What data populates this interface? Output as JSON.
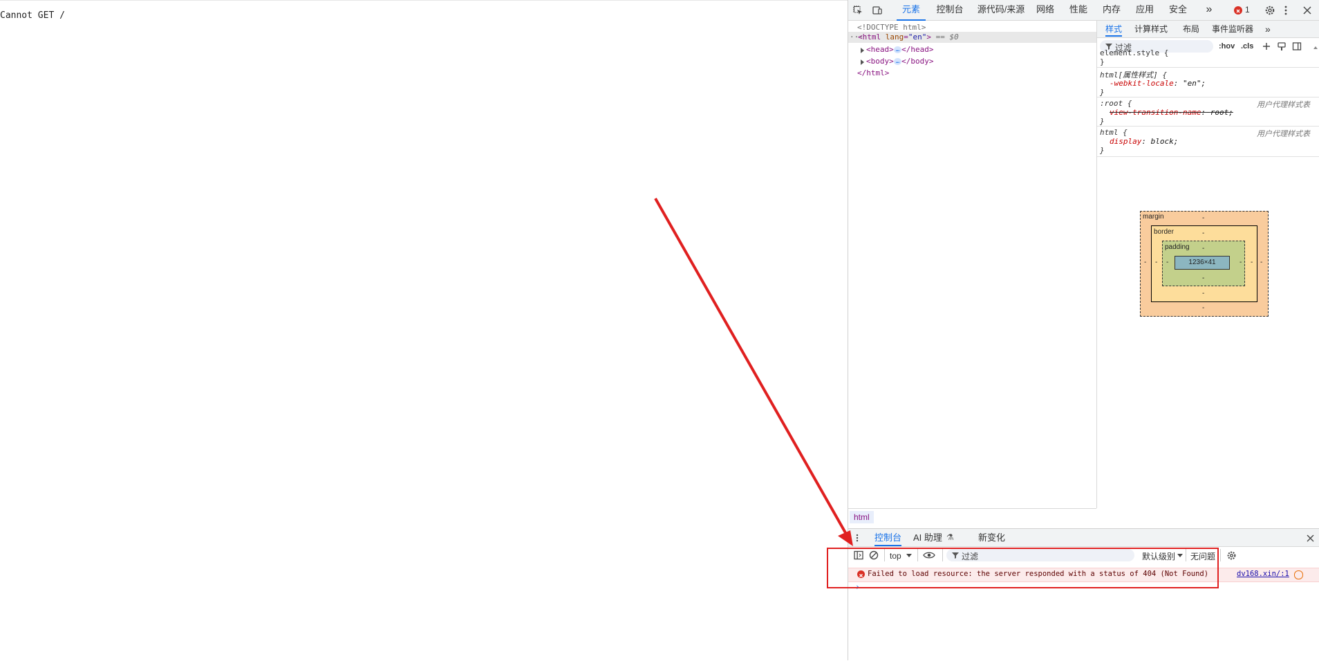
{
  "page": {
    "text": "Cannot GET /"
  },
  "devtools": {
    "tabs": [
      "元素",
      "控制台",
      "源代码/来源",
      "网络",
      "性能",
      "内存",
      "应用",
      "安全"
    ],
    "active_tab": "元素",
    "more_tabs": "»",
    "error_count": "1",
    "dom": {
      "doctype": "<!DOCTYPE html>",
      "html_open": "<html",
      "lang_attr": "lang",
      "lang_value": "\"en\"",
      "html_close_bracket": ">",
      "selected_marker": "== $0",
      "head_open": "<head>",
      "head_close": "</head>",
      "body_open": "<body>",
      "body_close": "</body>",
      "html_close": "</html>",
      "dots": "…",
      "row_dots": "···"
    },
    "breadcrumb": "html",
    "styles": {
      "tabs": [
        "样式",
        "计算样式",
        "布局",
        "事件监听器"
      ],
      "more": "»",
      "filter_placeholder": "过滤",
      "hov": ":hov",
      "cls": ".cls",
      "rules": [
        {
          "selector": "element.style {",
          "close": "}"
        },
        {
          "selector": "html[属性样式] {",
          "prop": "-webkit-locale",
          "value": "\"en\";",
          "close": "}"
        },
        {
          "selector": ":root {",
          "prop": "view-transition-name",
          "value": "root;",
          "source": "用户代理样式表",
          "close": "}"
        },
        {
          "selector": "html {",
          "prop": "display",
          "value": "block;",
          "source": "用户代理样式表",
          "close": "}"
        }
      ],
      "colon": ":"
    },
    "box_model": {
      "margin": "margin",
      "border": "border",
      "padding": "padding",
      "content": "1236×41",
      "dash": "-"
    },
    "drawer": {
      "tabs": [
        "控制台",
        "AI 助理",
        "新变化"
      ],
      "ai_flask": "⚗",
      "context": "top",
      "filter_placeholder": "过滤",
      "level": "默认级别",
      "issues": "无问题",
      "error_message": "Failed to load resource: the server responded with a status of 404 (Not Found)",
      "error_source": "dv168.xin/:1",
      "prompt": "›"
    }
  },
  "annotation": {
    "color": "#e02020"
  },
  "colors": {
    "accent": "#1a73e8",
    "error": "#d93025"
  }
}
